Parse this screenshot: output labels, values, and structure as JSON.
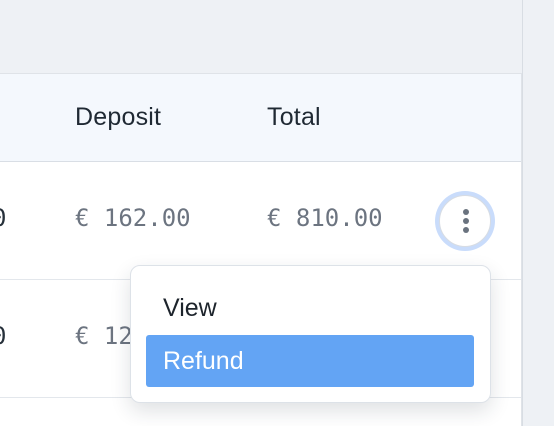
{
  "table": {
    "columns": {
      "deposit": "Deposit",
      "total": "Total"
    },
    "rows": [
      {
        "leading_fragment": "0",
        "deposit": "€ 162.00",
        "total": "€ 810.00"
      },
      {
        "leading_fragment": "0",
        "deposit": "€ 12",
        "total": ""
      }
    ]
  },
  "actions_menu": {
    "items": [
      {
        "label": "View",
        "state": "default"
      },
      {
        "label": "Refund",
        "state": "highlighted"
      }
    ]
  },
  "icons": {
    "row_actions": "more-vertical-icon"
  },
  "colors": {
    "background": "#eef1f5",
    "header_background": "#f4f8fd",
    "highlight": "#63a4f4",
    "focus_ring": "#c9dcfb",
    "amount_text": "#6c7480"
  }
}
